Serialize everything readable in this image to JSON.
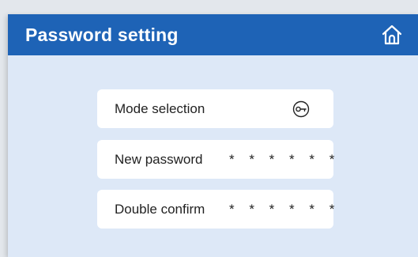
{
  "header": {
    "title": "Password setting",
    "home_icon": "home-icon",
    "background": "#1e63b6"
  },
  "rows": [
    {
      "label": "Mode selection",
      "icon": "key-icon"
    },
    {
      "label": "New password",
      "value": "* * * * * *"
    },
    {
      "label": "Double confirm",
      "value": "* * * * * *"
    }
  ],
  "colors": {
    "panel_background": "#dde8f7",
    "row_background": "#ffffff",
    "text": "#222222"
  }
}
